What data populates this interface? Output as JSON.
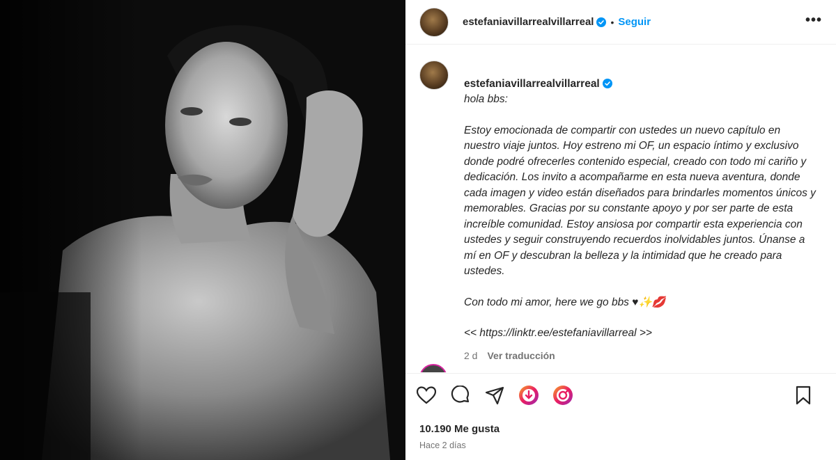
{
  "post": {
    "username": "estefaniavillarrealvillarreal",
    "follow_label": "Seguir",
    "dot": "•",
    "more_label": "•••",
    "caption_greeting": "hola bbs:",
    "caption_body": "Estoy emocionada de compartir con ustedes un nuevo capítulo en nuestro viaje juntos. Hoy estreno mi OF, un espacio íntimo y exclusivo donde podré ofrecerles contenido especial, creado con todo mi cariño y dedicación. Los invito a acompañarme en esta nueva aventura, donde cada imagen y video están diseñados para brindarles momentos únicos y memorables. Gracias por su constante apoyo y por ser parte de esta increíble comunidad. Estoy ansiosa por compartir esta experiencia con ustedes y seguir construyendo recuerdos inolvidables juntos. Únanse a mí en OF y descubran la belleza y la intimidad que he creado para ustedes.",
    "caption_signoff": "Con todo mi amor, here we go bbs ♥✨💋",
    "caption_link": "<< https://linktr.ee/estefaniavillarreal >>",
    "caption_age": "2 d",
    "translate_label": "Ver traducción",
    "likes": "10.190 Me gusta",
    "posted": "Hace 2 días"
  },
  "icons": {
    "like": "heart-icon",
    "comment": "comment-icon",
    "share": "share-icon",
    "save": "bookmark-icon"
  },
  "colors": {
    "accent": "#0095f6",
    "verified": "#0095f6",
    "muted": "#737373"
  }
}
